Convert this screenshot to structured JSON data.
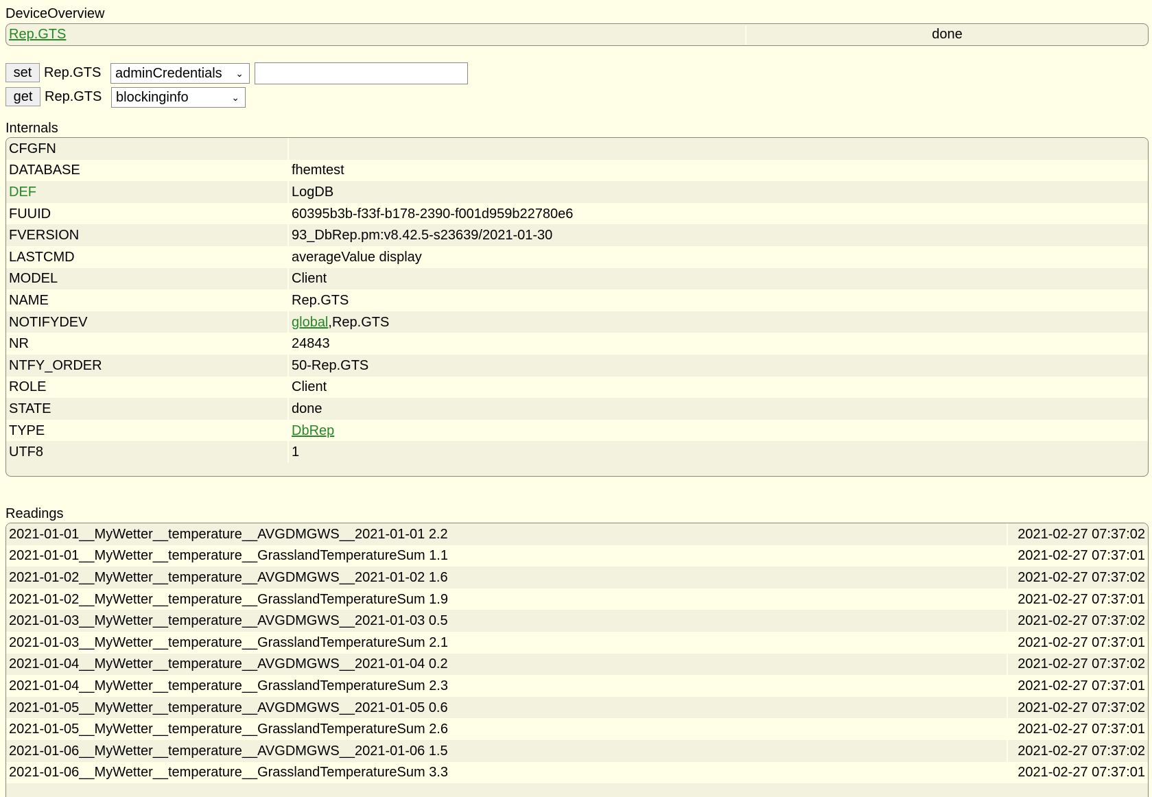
{
  "device_overview": {
    "title": "DeviceOverview",
    "device_name": "Rep.GTS",
    "state": "done"
  },
  "set_command": {
    "button_label": "set",
    "device": "Rep.GTS",
    "selected": "adminCredentials",
    "value": ""
  },
  "get_command": {
    "button_label": "get",
    "device": "Rep.GTS",
    "selected": "blockinginfo"
  },
  "internals": {
    "title": "Internals",
    "rows": [
      {
        "key": "CFGFN",
        "value": ""
      },
      {
        "key": "DATABASE",
        "value": "fhemtest"
      },
      {
        "key": "DEF",
        "value": "LogDB"
      },
      {
        "key": "FUUID",
        "value": "60395b3b-f33f-b178-2390-f001d959b22780e6"
      },
      {
        "key": "FVERSION",
        "value": "93_DbRep.pm:v8.42.5-s23639/2021-01-30"
      },
      {
        "key": "LASTCMD",
        "value": "averageValue display"
      },
      {
        "key": "MODEL",
        "value": "Client"
      },
      {
        "key": "NAME",
        "value": "Rep.GTS"
      },
      {
        "key": "NOTIFYDEV",
        "value_link": "global",
        "value_rest": ",Rep.GTS"
      },
      {
        "key": "NR",
        "value": "24843"
      },
      {
        "key": "NTFY_ORDER",
        "value": "50-Rep.GTS"
      },
      {
        "key": "ROLE",
        "value": "Client"
      },
      {
        "key": "STATE",
        "value": "done"
      },
      {
        "key": "TYPE",
        "value_link": "DbRep"
      },
      {
        "key": "UTF8",
        "value": "1"
      }
    ]
  },
  "readings": {
    "title": "Readings",
    "rows": [
      {
        "name": "2021-01-01__MyWetter__temperature__AVGDMGWS__2021-01-01",
        "value": "2.2",
        "time": "2021-02-27 07:37:02"
      },
      {
        "name": "2021-01-01__MyWetter__temperature__GrasslandTemperatureSum",
        "value": "1.1",
        "time": "2021-02-27 07:37:01"
      },
      {
        "name": "2021-01-02__MyWetter__temperature__AVGDMGWS__2021-01-02",
        "value": "1.6",
        "time": "2021-02-27 07:37:02"
      },
      {
        "name": "2021-01-02__MyWetter__temperature__GrasslandTemperatureSum",
        "value": "1.9",
        "time": "2021-02-27 07:37:01"
      },
      {
        "name": "2021-01-03__MyWetter__temperature__AVGDMGWS__2021-01-03",
        "value": "0.5",
        "time": "2021-02-27 07:37:02"
      },
      {
        "name": "2021-01-03__MyWetter__temperature__GrasslandTemperatureSum",
        "value": "2.1",
        "time": "2021-02-27 07:37:01"
      },
      {
        "name": "2021-01-04__MyWetter__temperature__AVGDMGWS__2021-01-04",
        "value": "0.2",
        "time": "2021-02-27 07:37:02"
      },
      {
        "name": "2021-01-04__MyWetter__temperature__GrasslandTemperatureSum",
        "value": "2.3",
        "time": "2021-02-27 07:37:01"
      },
      {
        "name": "2021-01-05__MyWetter__temperature__AVGDMGWS__2021-01-05",
        "value": "0.6",
        "time": "2021-02-27 07:37:02"
      },
      {
        "name": "2021-01-05__MyWetter__temperature__GrasslandTemperatureSum",
        "value": "2.6",
        "time": "2021-02-27 07:37:01"
      },
      {
        "name": "2021-01-06__MyWetter__temperature__AVGDMGWS__2021-01-06",
        "value": "1.5",
        "time": "2021-02-27 07:37:02"
      },
      {
        "name": "2021-01-06__MyWetter__temperature__GrasslandTemperatureSum",
        "value": "3.3",
        "time": "2021-02-27 07:37:01"
      }
    ]
  },
  "colors": {
    "background": "#FFFFE7",
    "row_alt": "#F2F2DE",
    "link": "#278727"
  }
}
